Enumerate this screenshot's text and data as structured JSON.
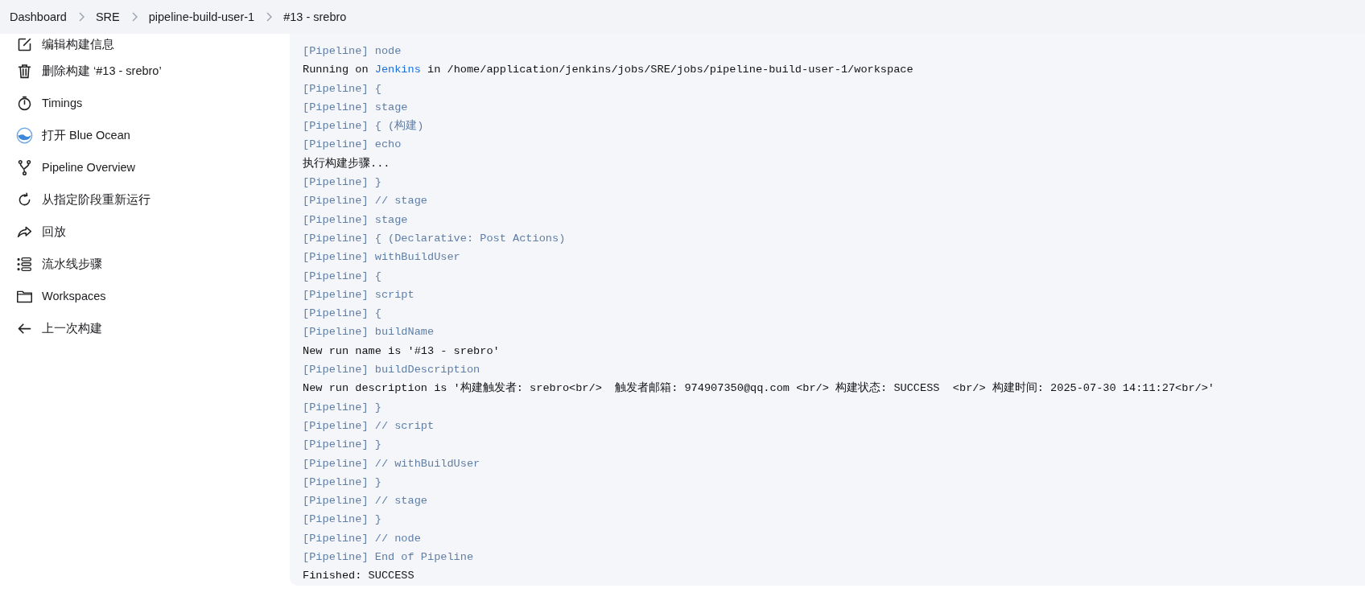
{
  "breadcrumbs": [
    {
      "label": "Dashboard"
    },
    {
      "label": "SRE"
    },
    {
      "label": "pipeline-build-user-1"
    },
    {
      "label": "#13 - srebro"
    }
  ],
  "sidebar": {
    "items": [
      {
        "label": "编辑构建信息",
        "kind": "edit"
      },
      {
        "label": "删除构建 ‘#13 - srebro’",
        "kind": "trash"
      },
      {
        "label": "Timings",
        "kind": "stopwatch"
      },
      {
        "label": "打开 Blue Ocean",
        "kind": "ocean"
      },
      {
        "label": "Pipeline Overview",
        "kind": "branch"
      },
      {
        "label": "从指定阶段重新运行",
        "kind": "rerun"
      },
      {
        "label": "回放",
        "kind": "replay"
      },
      {
        "label": "流水线步骤",
        "kind": "steps"
      },
      {
        "label": "Workspaces",
        "kind": "folder"
      },
      {
        "label": "上一次构建",
        "kind": "back"
      }
    ]
  },
  "console": {
    "lines": [
      {
        "kind": "pipeline",
        "text": "[Pipeline] node"
      },
      {
        "kind": "link",
        "before": "Running on ",
        "link": "Jenkins",
        "after": " in /home/application/jenkins/jobs/SRE/jobs/pipeline-build-user-1/workspace"
      },
      {
        "kind": "pipeline",
        "text": "[Pipeline] {"
      },
      {
        "kind": "pipeline",
        "text": "[Pipeline] stage"
      },
      {
        "kind": "pipeline",
        "text": "[Pipeline] { (构建)"
      },
      {
        "kind": "pipeline",
        "text": "[Pipeline] echo"
      },
      {
        "kind": "plain",
        "text": "执行构建步骤..."
      },
      {
        "kind": "pipeline",
        "text": "[Pipeline] }"
      },
      {
        "kind": "pipeline",
        "text": "[Pipeline] // stage"
      },
      {
        "kind": "pipeline",
        "text": "[Pipeline] stage"
      },
      {
        "kind": "pipeline",
        "text": "[Pipeline] { (Declarative: Post Actions)"
      },
      {
        "kind": "pipeline",
        "text": "[Pipeline] withBuildUser"
      },
      {
        "kind": "pipeline",
        "text": "[Pipeline] {"
      },
      {
        "kind": "pipeline",
        "text": "[Pipeline] script"
      },
      {
        "kind": "pipeline",
        "text": "[Pipeline] {"
      },
      {
        "kind": "pipeline",
        "text": "[Pipeline] buildName"
      },
      {
        "kind": "plain",
        "text": "New run name is '#13 - srebro'"
      },
      {
        "kind": "pipeline",
        "text": "[Pipeline] buildDescription"
      },
      {
        "kind": "plain",
        "text": "New run description is '构建触发者: srebro<br/>  触发者邮箱: 974907350@qq.com <br/> 构建状态: SUCCESS  <br/> 构建时间: 2025-07-30 14:11:27<br/>'"
      },
      {
        "kind": "pipeline",
        "text": "[Pipeline] }"
      },
      {
        "kind": "pipeline",
        "text": "[Pipeline] // script"
      },
      {
        "kind": "pipeline",
        "text": "[Pipeline] }"
      },
      {
        "kind": "pipeline",
        "text": "[Pipeline] // withBuildUser"
      },
      {
        "kind": "pipeline",
        "text": "[Pipeline] }"
      },
      {
        "kind": "pipeline",
        "text": "[Pipeline] // stage"
      },
      {
        "kind": "pipeline",
        "text": "[Pipeline] }"
      },
      {
        "kind": "pipeline",
        "text": "[Pipeline] // node"
      },
      {
        "kind": "pipeline",
        "text": "[Pipeline] End of Pipeline"
      },
      {
        "kind": "plain",
        "text": "Finished: SUCCESS"
      }
    ]
  }
}
